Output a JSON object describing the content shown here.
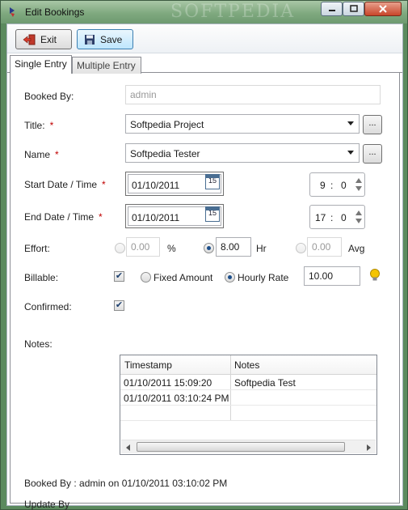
{
  "window": {
    "title": "Edit Bookings",
    "watermark": "SOFTPEDIA"
  },
  "toolbar": {
    "exit_label": "Exit",
    "save_label": "Save"
  },
  "tabs": [
    {
      "label": "Single Entry",
      "active": true
    },
    {
      "label": "Multiple Entry",
      "active": false
    }
  ],
  "form": {
    "booked_by": {
      "label": "Booked By:",
      "value": "admin"
    },
    "title": {
      "label": "Title:",
      "required_mark": "*",
      "value": "Softpedia Project",
      "more_label": "..."
    },
    "name": {
      "label": "Name",
      "required_mark": "*",
      "value": "Softpedia Tester",
      "more_label": "..."
    },
    "start": {
      "label": "Start Date / Time",
      "required_mark": "*",
      "date": "01/10/2011",
      "hour": "9",
      "sep": ":",
      "minute": "0",
      "cal_day": "15"
    },
    "end": {
      "label": "End Date / Time",
      "required_mark": "*",
      "date": "01/10/2011",
      "hour": "17",
      "sep": ":",
      "minute": "0",
      "cal_day": "15"
    },
    "effort": {
      "label": "Effort:",
      "percent_value": "0.00",
      "percent_unit": "%",
      "hours_value": "8.00",
      "hours_unit": "Hr",
      "avg_value": "0.00",
      "avg_unit": "Avg",
      "selected": "Hr"
    },
    "billable": {
      "label": "Billable:",
      "checked": true,
      "fixed_label": "Fixed Amount",
      "hourly_label": "Hourly Rate",
      "selected": "Hourly Rate",
      "rate_value": "10.00"
    },
    "confirmed": {
      "label": "Confirmed:",
      "checked": true
    },
    "notes": {
      "label": "Notes:",
      "columns": [
        "Timestamp",
        "Notes"
      ],
      "rows": [
        [
          "01/10/2011 15:09:20",
          "Softpedia Test"
        ],
        [
          "01/10/2011 03:10:24 PM",
          ""
        ]
      ]
    },
    "footer": {
      "booked_by_text": "Booked By : admin on 01/10/2011 03:10:02 PM",
      "update_by_text": "Update By"
    }
  },
  "colors": {
    "title_bg": "#7fa97f",
    "required": "#c00000",
    "save_button_bg": "#bee6fd",
    "bulb": "#f4c400"
  }
}
